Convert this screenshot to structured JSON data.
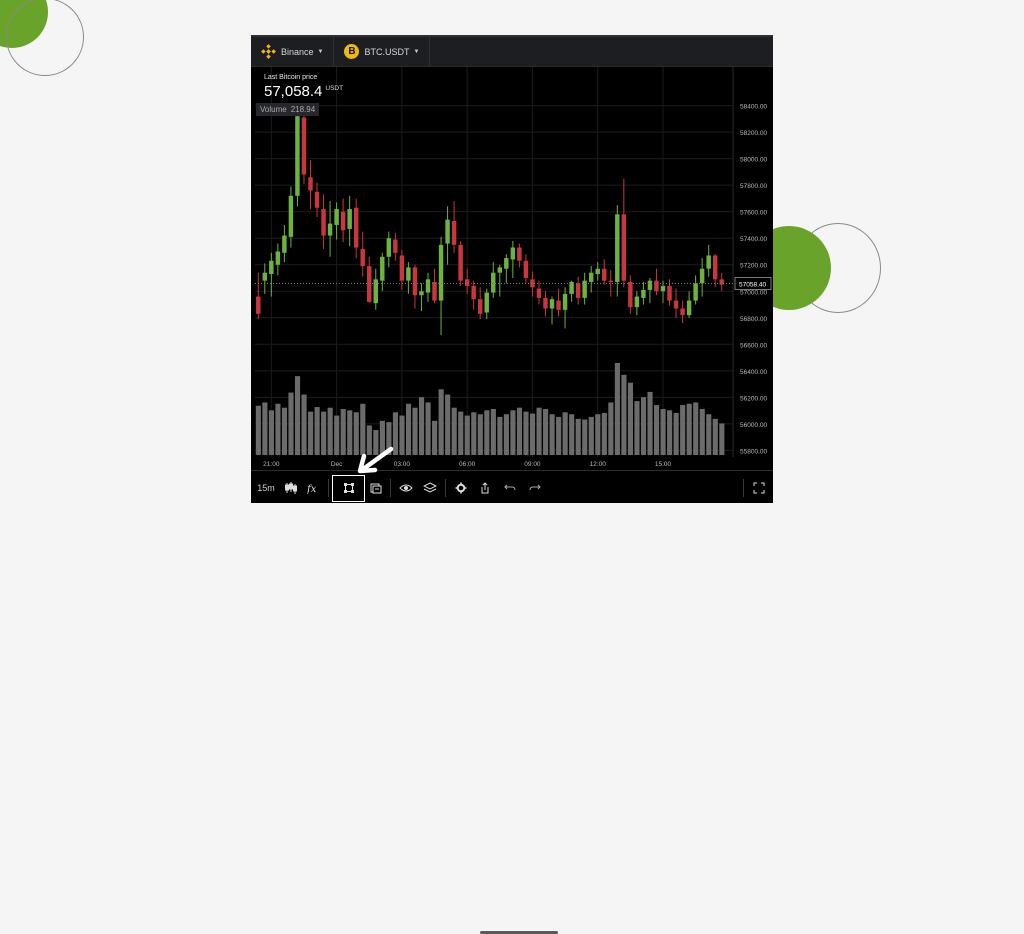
{
  "topbar": {
    "exchange": "Binance",
    "symbol": "BTC.USDT",
    "coin_glyph": "B",
    "exchange_icon": "binance-diamond-icon",
    "coin_icon": "bitcoin-icon"
  },
  "price": {
    "label": "Last Bitcoin price",
    "value": "57,058.4",
    "unit": "USDT"
  },
  "volume": {
    "label": "Volume",
    "value": "218.94"
  },
  "toolbar": {
    "interval": "15m",
    "icons": [
      "candles-icon",
      "fx-indicator-icon",
      "drawing-tool-icon",
      "snapshot-icon",
      "eye-icon",
      "layers-icon",
      "gear-icon",
      "share-icon",
      "undo-icon",
      "redo-icon",
      "fullscreen-icon"
    ],
    "highlighted": "drawing-tool-icon"
  },
  "colors": {
    "up": "#6cb33f",
    "down": "#c9363e",
    "volume": "#6b6b6b",
    "accent": "#6aa329",
    "binance": "#f0b90b"
  },
  "chart_data": {
    "type": "candlestick",
    "price_axis_labels": [
      "58400.00",
      "58200.00",
      "58000.00",
      "57800.00",
      "57600.00",
      "57400.00",
      "57200.00",
      "57000.00",
      "56800.00",
      "56600.00",
      "56400.00",
      "56200.00",
      "56000.00",
      "55800.00"
    ],
    "current_price_label": "57058.40",
    "time_axis_labels": [
      "21:00",
      "Dec",
      "03:00",
      "06:00",
      "09:00",
      "12:00",
      "15:00"
    ],
    "ylim": [
      55750,
      58450
    ],
    "candles": [
      [
        56960,
        57140,
        56790,
        56830
      ],
      [
        57080,
        57210,
        56980,
        57140
      ],
      [
        57130,
        57290,
        56960,
        57230
      ],
      [
        57200,
        57360,
        57120,
        57300
      ],
      [
        57290,
        57500,
        57220,
        57420
      ],
      [
        57410,
        57790,
        57330,
        57720
      ],
      [
        57720,
        58360,
        57640,
        58320
      ],
      [
        58310,
        58390,
        57810,
        57880
      ],
      [
        57860,
        57990,
        57620,
        57760
      ],
      [
        57750,
        57820,
        57560,
        57630
      ],
      [
        57620,
        57730,
        57320,
        57420
      ],
      [
        57420,
        57680,
        57260,
        57510
      ],
      [
        57500,
        57670,
        57390,
        57620
      ],
      [
        57600,
        57700,
        57370,
        57460
      ],
      [
        57470,
        57720,
        57340,
        57620
      ],
      [
        57630,
        57700,
        57250,
        57330
      ],
      [
        57320,
        57450,
        57110,
        57190
      ],
      [
        57190,
        57260,
        56910,
        56920
      ],
      [
        56910,
        57170,
        56860,
        57090
      ],
      [
        57080,
        57290,
        57000,
        57260
      ],
      [
        57260,
        57450,
        57180,
        57400
      ],
      [
        57390,
        57440,
        57230,
        57290
      ],
      [
        57270,
        57310,
        57010,
        57080
      ],
      [
        57080,
        57220,
        56980,
        57180
      ],
      [
        57180,
        57200,
        56870,
        56970
      ],
      [
        56970,
        57060,
        56850,
        57000
      ],
      [
        56990,
        57140,
        56920,
        57090
      ],
      [
        57070,
        57170,
        56910,
        56930
      ],
      [
        56930,
        57410,
        56670,
        57350
      ],
      [
        57360,
        57640,
        57200,
        57540
      ],
      [
        57530,
        57680,
        57290,
        57350
      ],
      [
        57350,
        57380,
        57040,
        57080
      ],
      [
        57090,
        57170,
        56980,
        57040
      ],
      [
        57040,
        57080,
        56860,
        56940
      ],
      [
        56940,
        57030,
        56790,
        56830
      ],
      [
        56840,
        57020,
        56790,
        56990
      ],
      [
        56990,
        57220,
        56950,
        57140
      ],
      [
        57140,
        57200,
        56960,
        57180
      ],
      [
        57170,
        57280,
        57060,
        57250
      ],
      [
        57240,
        57380,
        57100,
        57330
      ],
      [
        57330,
        57360,
        57180,
        57230
      ],
      [
        57230,
        57280,
        57060,
        57100
      ],
      [
        57090,
        57150,
        56960,
        57030
      ],
      [
        57020,
        57080,
        56900,
        56950
      ],
      [
        56950,
        57000,
        56810,
        56870
      ],
      [
        56870,
        56960,
        56750,
        56940
      ],
      [
        56930,
        57020,
        56810,
        56860
      ],
      [
        56860,
        57030,
        56720,
        56980
      ],
      [
        56980,
        57080,
        56920,
        57070
      ],
      [
        57060,
        57110,
        56900,
        56950
      ],
      [
        56950,
        57140,
        56900,
        57080
      ],
      [
        57070,
        57190,
        56990,
        57140
      ],
      [
        57130,
        57220,
        57080,
        57170
      ],
      [
        57170,
        57240,
        57050,
        57080
      ],
      [
        57080,
        57160,
        56960,
        57070
      ],
      [
        57070,
        57650,
        56960,
        57580
      ],
      [
        57580,
        57850,
        57030,
        57080
      ],
      [
        57070,
        57120,
        56830,
        56880
      ],
      [
        56880,
        57000,
        56820,
        56960
      ],
      [
        56950,
        57070,
        56900,
        57010
      ],
      [
        57010,
        57100,
        56910,
        57080
      ],
      [
        57080,
        57170,
        56970,
        57000
      ],
      [
        57000,
        57080,
        56910,
        57040
      ],
      [
        57040,
        57090,
        56890,
        56930
      ],
      [
        56930,
        57020,
        56800,
        56870
      ],
      [
        56870,
        56930,
        56760,
        56820
      ],
      [
        56820,
        57000,
        56800,
        56930
      ],
      [
        56930,
        57120,
        56900,
        57060
      ],
      [
        57060,
        57250,
        56960,
        57170
      ],
      [
        57170,
        57350,
        57110,
        57270
      ],
      [
        57270,
        57280,
        57030,
        57090
      ],
      [
        57090,
        57140,
        57000,
        57050
      ]
    ],
    "volumes": [
      75,
      80,
      68,
      78,
      72,
      95,
      120,
      92,
      66,
      73,
      66,
      72,
      60,
      70,
      68,
      65,
      78,
      45,
      38,
      52,
      50,
      65,
      60,
      78,
      72,
      88,
      80,
      52,
      100,
      92,
      72,
      66,
      60,
      65,
      62,
      68,
      70,
      58,
      62,
      68,
      72,
      66,
      63,
      72,
      70,
      62,
      58,
      65,
      62,
      55,
      54,
      58,
      62,
      64,
      80,
      140,
      122,
      110,
      82,
      88,
      96,
      76,
      70,
      68,
      64,
      76,
      78,
      80,
      70,
      62,
      55,
      48
    ]
  }
}
